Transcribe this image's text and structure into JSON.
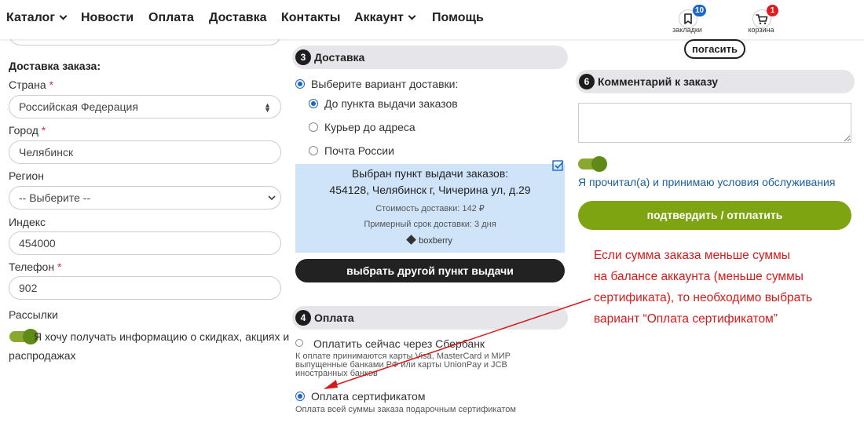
{
  "nav": {
    "items": [
      {
        "label": "Каталог",
        "has_dropdown": true
      },
      {
        "label": "Новости",
        "has_dropdown": false
      },
      {
        "label": "Оплата",
        "has_dropdown": false
      },
      {
        "label": "Доставка",
        "has_dropdown": false
      },
      {
        "label": "Контакты",
        "has_dropdown": false
      },
      {
        "label": "Аккаунт",
        "has_dropdown": true
      },
      {
        "label": "Помощь",
        "has_dropdown": false
      }
    ],
    "bookmarks": {
      "label": "закладки",
      "count": "10",
      "icon": "bookmark-icon",
      "badge_color": "#1a66c9"
    },
    "cart": {
      "label": "корзина",
      "count": "1",
      "icon": "cart-icon",
      "badge_color": "#e01b1b"
    }
  },
  "pay_off_button": "погасить",
  "delivery_form": {
    "title": "Доставка заказа:",
    "country": {
      "label": "Страна",
      "required_mark": "*",
      "value": "Российская Федерация"
    },
    "city": {
      "label": "Город",
      "required_mark": "*",
      "value": "Челябинск"
    },
    "region": {
      "label": "Регион",
      "value": "-- Выберите --"
    },
    "postal_code": {
      "label": "Индекс",
      "value": "454000"
    },
    "phone": {
      "label": "Телефон",
      "required_mark": "*",
      "value": "902"
    },
    "newsletter": {
      "label": "Рассылки",
      "toggle_text_1": "Я хочу получать информацию о скидках, акциях и",
      "toggle_text_2": "распродажах"
    }
  },
  "delivery": {
    "number": "3",
    "title": "Доставка",
    "choose_label": "Выберите вариант доставки:",
    "options": [
      {
        "label": "До пункта выдачи заказов",
        "selected": true
      },
      {
        "label": "Курьер до адреса",
        "selected": false
      },
      {
        "label": "Почта России",
        "selected": false
      }
    ],
    "pickup": {
      "line1": "Выбран пункт выдачи заказов:",
      "line2": "454128, Челябинск г, Чичерина ул, д.29",
      "cost": "Стоимость доставки: 142 ₽",
      "term": "Примерный срок доставки: 3 дня",
      "provider": "boxberry"
    },
    "change_button": "выбрать другой пункт выдачи"
  },
  "payment": {
    "number": "4",
    "title": "Оплата",
    "options": [
      {
        "label": "Оплатить сейчас через Сбербанк",
        "selected": false,
        "desc_lines": [
          "К оплате принимаются карты Visa, MasterCard и МИР",
          "выпущенные банками РФ или карты UnionPay и JCB",
          "иностранных банков"
        ]
      },
      {
        "label": "Оплата сертификатом",
        "selected": true,
        "desc_lines": [
          "Оплата всей суммы заказа подарочным сертификатом"
        ]
      }
    ]
  },
  "comment": {
    "number": "6",
    "title": "Комментарий к заказу",
    "placeholder": ""
  },
  "terms": {
    "text": "Я прочитал(а) и принимаю условия обслуживания",
    "accepted": true
  },
  "confirm_button": "подтвердить / отплатить",
  "annotation": {
    "lines": [
      "Если сумма заказа меньше суммы",
      "на балансе аккаунта (меньше суммы",
      "сертификата), то необходимо выбрать",
      "вариант “Оплата сертификатом”"
    ],
    "color": "#d61a1a"
  },
  "colors": {
    "accent_green": "#7fa412",
    "dark": "#222222",
    "pickup_bg": "#cfe4f9",
    "link_blue": "#1a5fa0"
  }
}
